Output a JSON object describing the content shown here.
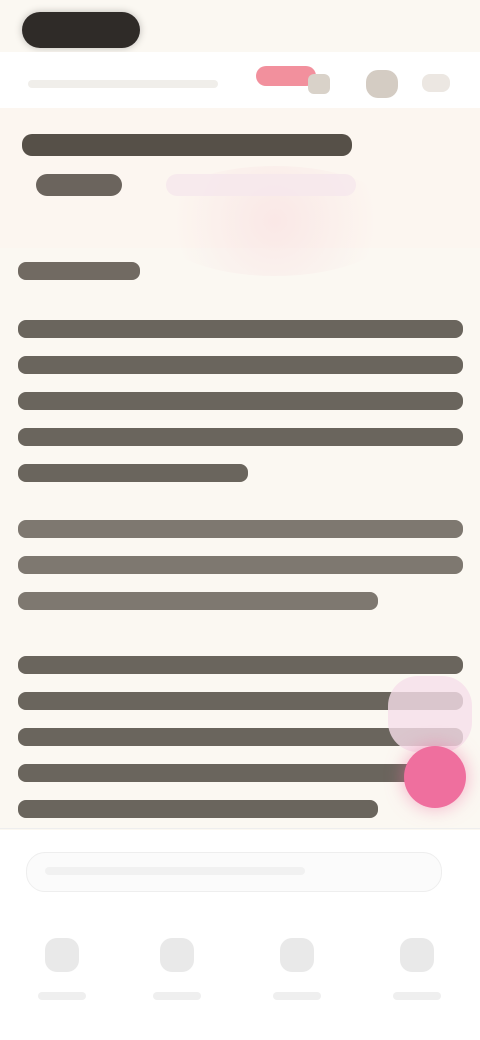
{
  "header": {
    "title": "",
    "status": ""
  },
  "hero": {
    "title": "",
    "tag": ""
  },
  "content": {
    "section_label": "",
    "paragraphs": [
      "",
      "",
      "",
      ""
    ]
  },
  "compose": {
    "placeholder": ""
  },
  "nav": {
    "items": [
      {
        "label": ""
      },
      {
        "label": ""
      },
      {
        "label": ""
      },
      {
        "label": ""
      }
    ]
  },
  "colors": {
    "background": "#fbf8f2",
    "accent": "#ef6f9e",
    "badge": "#f07d8c",
    "text": "#2b2621"
  },
  "icons": {
    "top_right_1": "gear-icon",
    "top_right_2": "more-icon",
    "fab": "add-icon",
    "nav_1": "home-icon",
    "nav_2": "search-icon",
    "nav_3": "chat-icon",
    "nav_4": "profile-icon"
  }
}
